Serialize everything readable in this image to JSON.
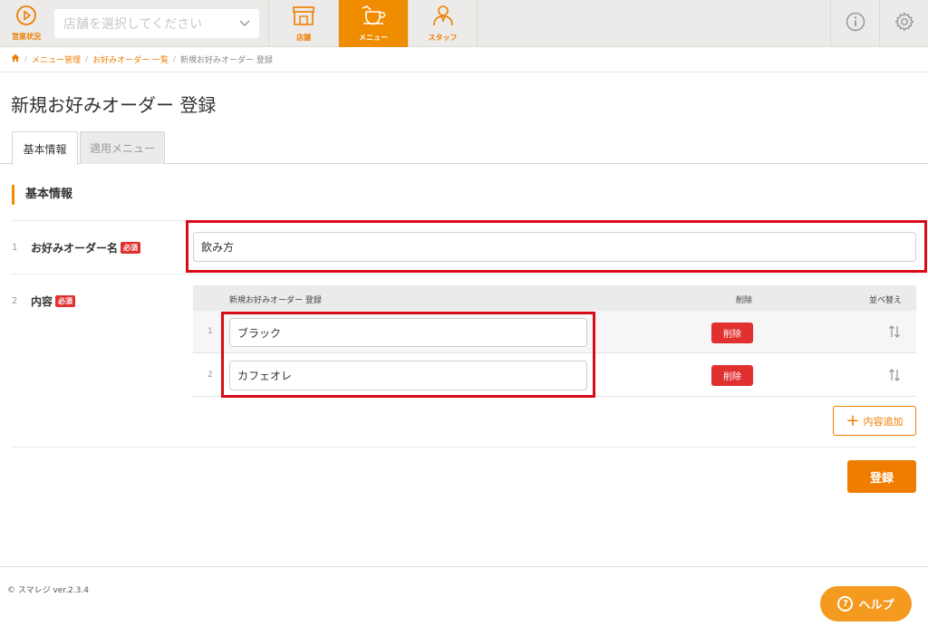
{
  "header": {
    "status_label": "営業状況",
    "store_select_placeholder": "店舗を選択してください",
    "nav": [
      {
        "label": "店舗",
        "icon": "store-icon"
      },
      {
        "label": "メニュー",
        "icon": "cup-icon"
      },
      {
        "label": "スタッフ",
        "icon": "staff-icon"
      }
    ],
    "active_nav": "メニュー",
    "right_icons": [
      "info-icon",
      "gear-icon"
    ]
  },
  "breadcrumb": {
    "items": [
      "メニュー管理",
      "お好みオーダー 一覧"
    ],
    "current": "新規お好みオーダー 登録"
  },
  "page_title": "新規お好みオーダー 登録",
  "tabs": [
    {
      "label": "基本情報",
      "active": true
    },
    {
      "label": "適用メニュー",
      "active": false
    }
  ],
  "section_title": "基本情報",
  "required_label": "必須",
  "fields": [
    {
      "no": "1",
      "label": "お好みオーダー名",
      "value": "飲み方"
    },
    {
      "no": "2",
      "label": "内容"
    }
  ],
  "content_table": {
    "headers": {
      "name": "新規お好みオーダー 登録",
      "delete": "削除",
      "sort": "並べ替え"
    },
    "rows": [
      {
        "no": "1",
        "value": "ブラック",
        "delete_label": "削除"
      },
      {
        "no": "2",
        "value": "カフェオレ",
        "delete_label": "削除"
      }
    ],
    "add_label": "内容追加"
  },
  "submit_label": "登録",
  "footer": {
    "copyright": "© スマレジ ver.2.3.4"
  },
  "help_label": "ヘルプ",
  "colors": {
    "accent": "#ef7d00",
    "danger": "#e03030",
    "highlight": "#d80c18"
  }
}
